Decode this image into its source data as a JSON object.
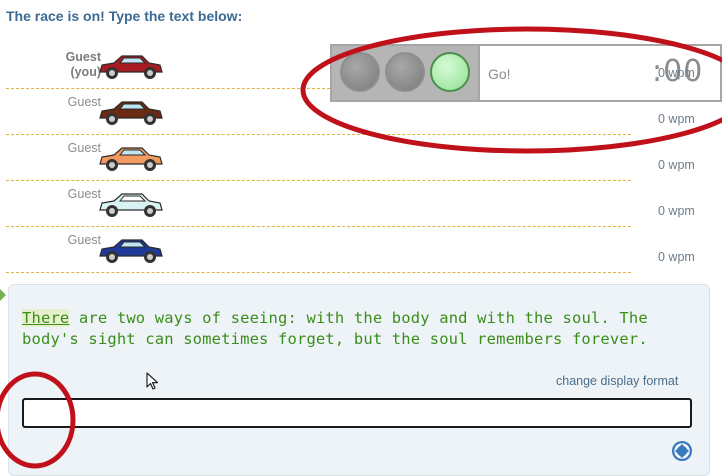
{
  "heading": "The race is on! Type the text below:",
  "racers": [
    {
      "name_line1": "Guest",
      "name_line2": "(you)",
      "wpm": "0 wpm",
      "car_color": "#a81b22"
    },
    {
      "name_line1": "Guest",
      "name_line2": "",
      "wpm": "0 wpm",
      "car_color": "#6b2a12"
    },
    {
      "name_line1": "Guest",
      "name_line2": "",
      "wpm": "0 wpm",
      "car_color": "#f29a5f"
    },
    {
      "name_line1": "Guest",
      "name_line2": "",
      "wpm": "0 wpm",
      "car_color": "#d9f2f4"
    },
    {
      "name_line1": "Guest",
      "name_line2": "",
      "wpm": "0 wpm",
      "car_color": "#1e3a9a"
    }
  ],
  "traffic_light": {
    "status": "Go!",
    "timer": ":00",
    "bulb_colors": [
      "#8e8e8e",
      "#8e8e8e",
      "#aef0b0"
    ]
  },
  "passage": {
    "typed": "There",
    "rest": " are two ways of seeing: with the body and with the soul. The body's sight can sometimes forget, but the soul remembers forever."
  },
  "change_format_label": "change display format",
  "input": {
    "value": "",
    "placeholder": ""
  },
  "colors": {
    "heading": "#3d6a94",
    "passage_text": "#3b8e1b",
    "lane_divider": "#e0b33a",
    "annotation": "#c0101a",
    "help_icon": "#3a7bbf"
  },
  "icons": {
    "help": "help-circle-icon",
    "cursor": "mouse-pointer-icon"
  }
}
